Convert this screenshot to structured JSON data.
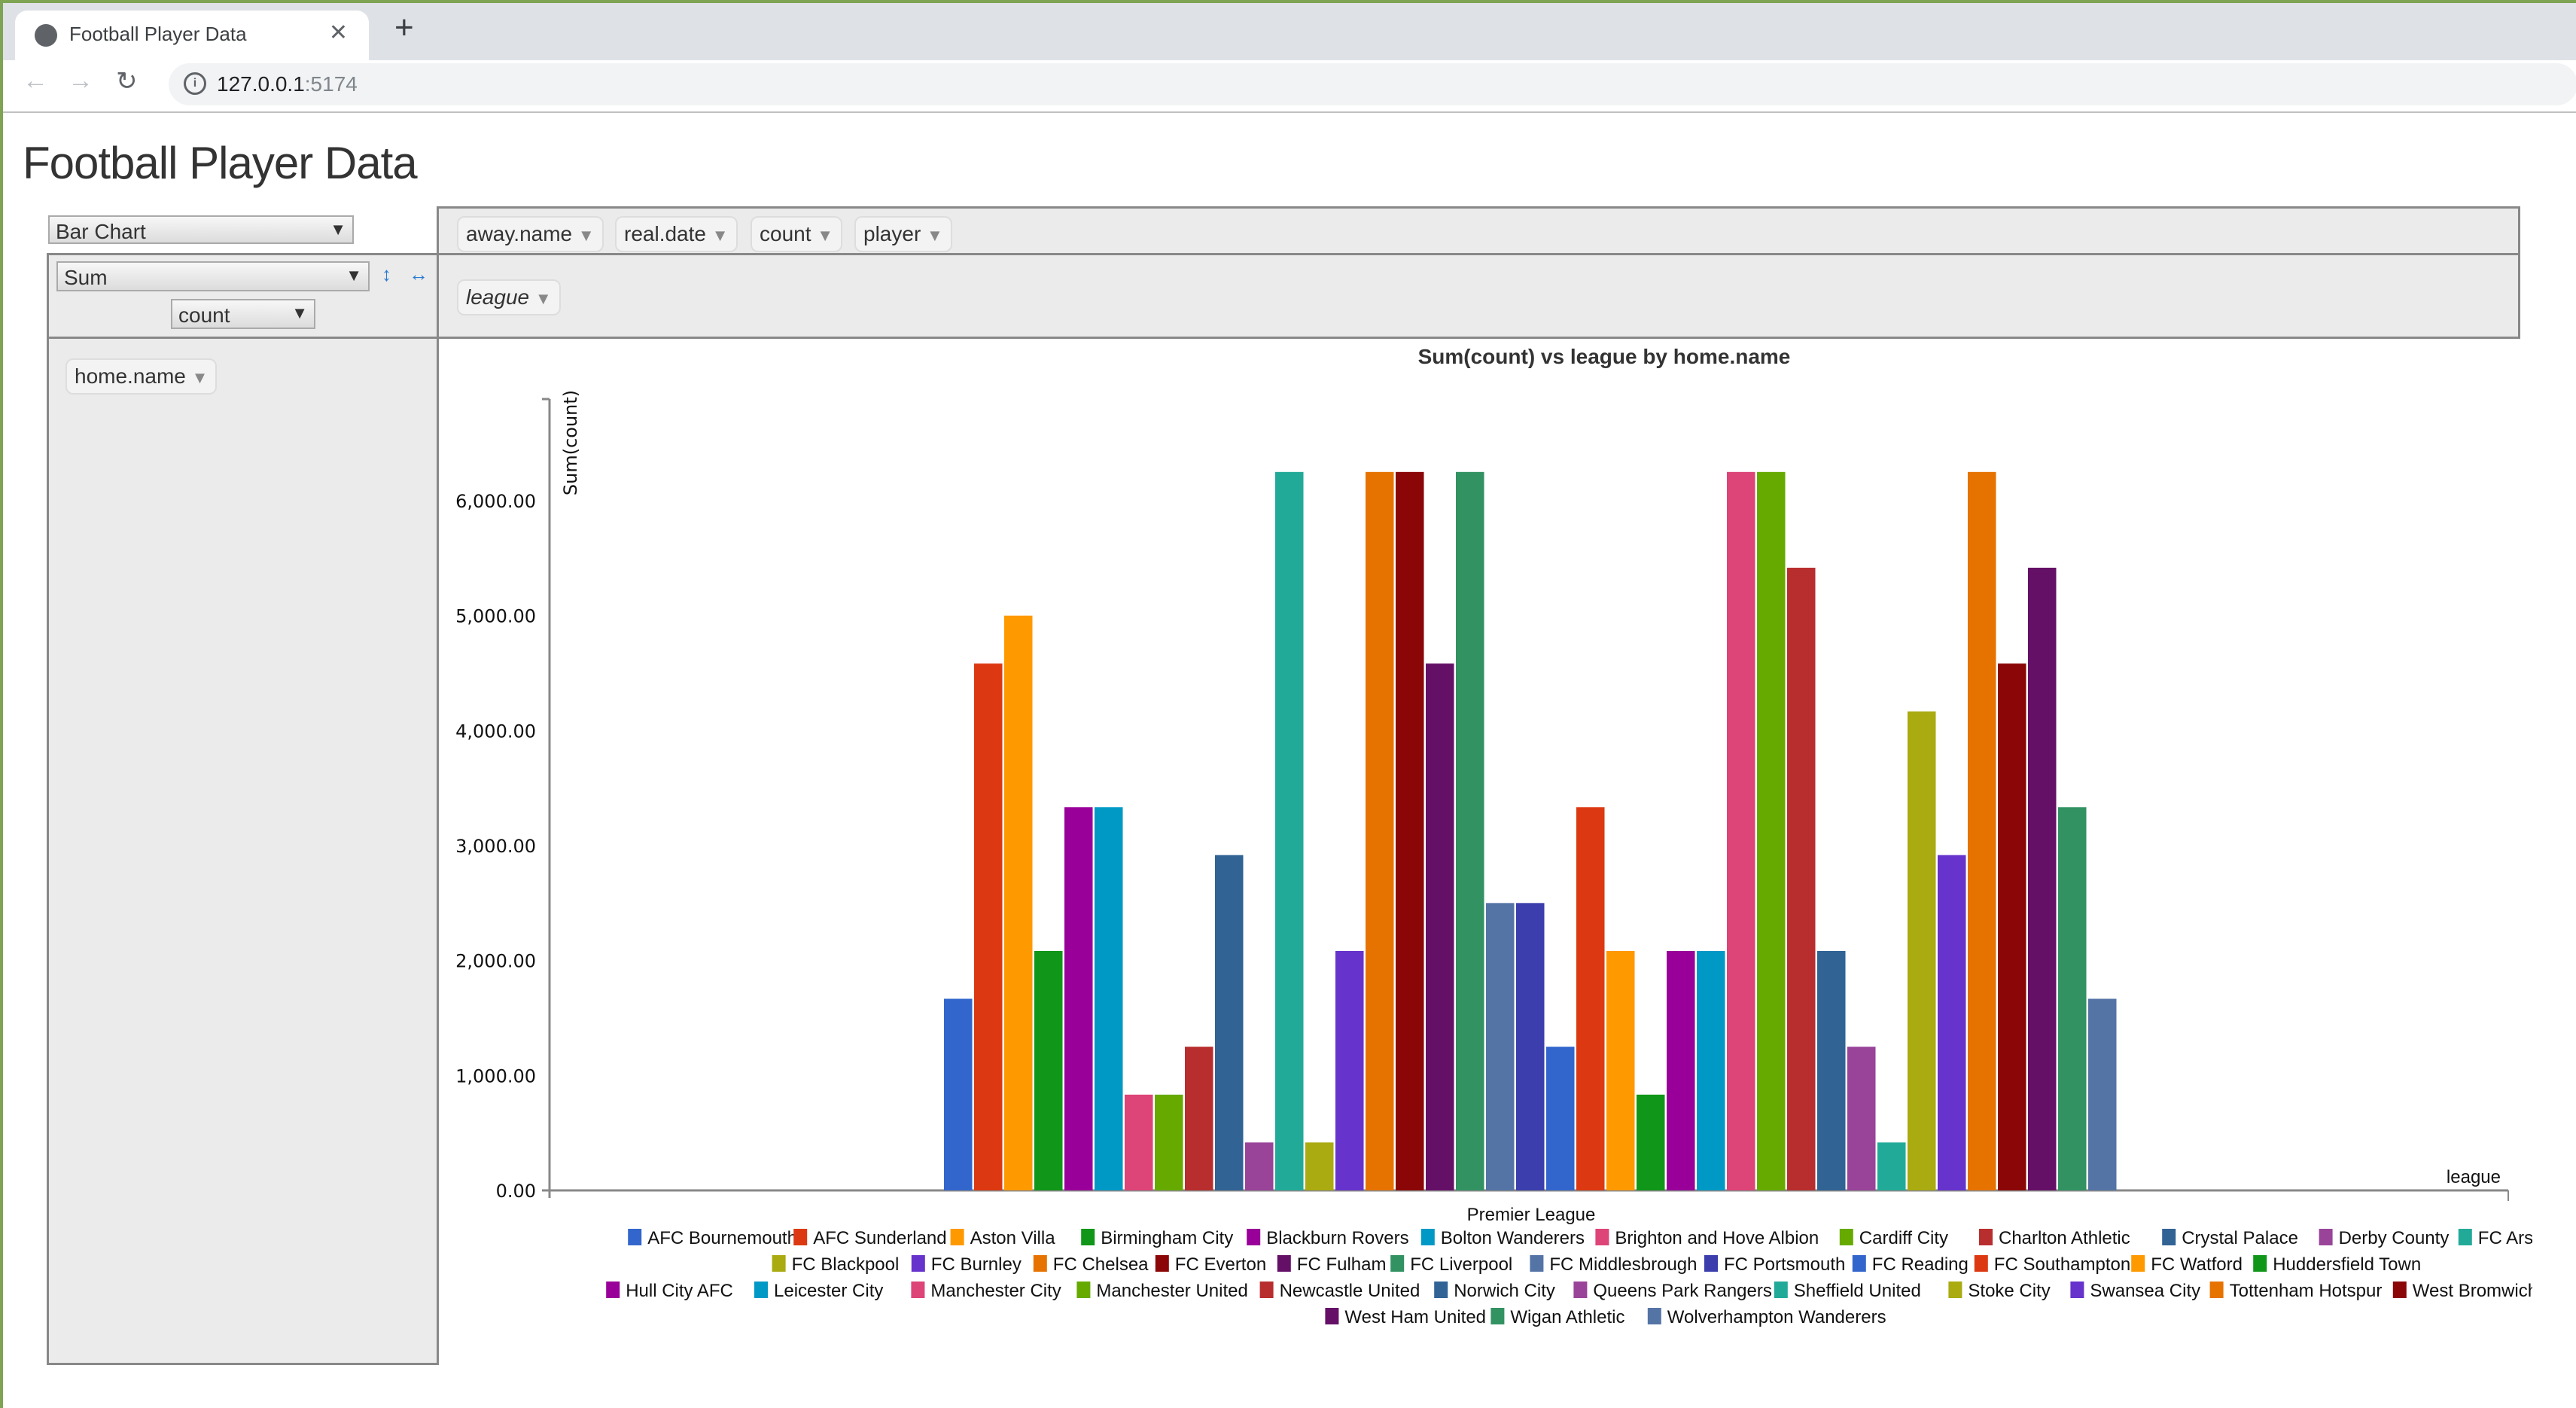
{
  "browser": {
    "tab_title": "Football Player Data",
    "url_host": "127.0.0.1",
    "url_port": ":5174"
  },
  "page": {
    "title": "Football Player Data"
  },
  "controls": {
    "renderer": "Bar Chart",
    "aggregator": "Sum",
    "aggregator_field": "count",
    "sort_row_icon": "↕",
    "sort_col_icon": "↔"
  },
  "unused_attributes": [
    "away.name",
    "real.date",
    "count",
    "player"
  ],
  "column_attributes": [
    "league"
  ],
  "row_attributes": [
    "home.name"
  ],
  "chart_data": {
    "type": "bar",
    "title": "Sum(count) vs league by home.name",
    "xlabel": "league",
    "ylabel": "Sum(count)",
    "categories": [
      "Premier League"
    ],
    "ylim": [
      0,
      6900
    ],
    "yticks": [
      "0.00",
      "1,000.00",
      "2,000.00",
      "3,000.00",
      "4,000.00",
      "5,000.00",
      "6,000.00"
    ],
    "legend_position": "bottom",
    "grid": false,
    "series": [
      {
        "name": "AFC Bournemouth",
        "color": "#3366cc",
        "values": [
          1667
        ]
      },
      {
        "name": "AFC Sunderland",
        "color": "#dc3912",
        "values": [
          4583
        ]
      },
      {
        "name": "Aston Villa",
        "color": "#ff9900",
        "values": [
          5000
        ]
      },
      {
        "name": "Birmingham City",
        "color": "#109618",
        "values": [
          2083
        ]
      },
      {
        "name": "Blackburn Rovers",
        "color": "#990099",
        "values": [
          3333
        ]
      },
      {
        "name": "Bolton Wanderers",
        "color": "#0099c6",
        "values": [
          3333
        ]
      },
      {
        "name": "Brighton and Hove Albion",
        "color": "#dd4477",
        "values": [
          833
        ]
      },
      {
        "name": "Cardiff City",
        "color": "#66aa00",
        "values": [
          833
        ]
      },
      {
        "name": "Charlton Athletic",
        "color": "#b82e2e",
        "values": [
          1250
        ]
      },
      {
        "name": "Crystal Palace",
        "color": "#316395",
        "values": [
          2917
        ]
      },
      {
        "name": "Derby County",
        "color": "#994499",
        "values": [
          417
        ]
      },
      {
        "name": "FC Arsenal",
        "color": "#22aa99",
        "values": [
          6250
        ]
      },
      {
        "name": "FC Blackpool",
        "color": "#aaaa11",
        "values": [
          417
        ]
      },
      {
        "name": "FC Burnley",
        "color": "#6633cc",
        "values": [
          2083
        ]
      },
      {
        "name": "FC Chelsea",
        "color": "#e67300",
        "values": [
          6250
        ]
      },
      {
        "name": "FC Everton",
        "color": "#8b0707",
        "values": [
          6250
        ]
      },
      {
        "name": "FC Fulham",
        "color": "#651067",
        "values": [
          4583
        ]
      },
      {
        "name": "FC Liverpool",
        "color": "#329262",
        "values": [
          6250
        ]
      },
      {
        "name": "FC Middlesbrough",
        "color": "#5574a6",
        "values": [
          2500
        ]
      },
      {
        "name": "FC Portsmouth",
        "color": "#3b3eac",
        "values": [
          2500
        ]
      },
      {
        "name": "FC Reading",
        "color": "#3366cc",
        "values": [
          1250
        ]
      },
      {
        "name": "FC Southampton",
        "color": "#dc3912",
        "values": [
          3333
        ]
      },
      {
        "name": "FC Watford",
        "color": "#ff9900",
        "values": [
          2083
        ]
      },
      {
        "name": "Huddersfield Town",
        "color": "#109618",
        "values": [
          833
        ]
      },
      {
        "name": "Hull City AFC",
        "color": "#990099",
        "values": [
          2083
        ]
      },
      {
        "name": "Leicester City",
        "color": "#0099c6",
        "values": [
          2083
        ]
      },
      {
        "name": "Manchester City",
        "color": "#dd4477",
        "values": [
          6250
        ]
      },
      {
        "name": "Manchester United",
        "color": "#66aa00",
        "values": [
          6250
        ]
      },
      {
        "name": "Newcastle United",
        "color": "#b82e2e",
        "values": [
          5417
        ]
      },
      {
        "name": "Norwich City",
        "color": "#316395",
        "values": [
          2083
        ]
      },
      {
        "name": "Queens Park Rangers",
        "color": "#994499",
        "values": [
          1250
        ]
      },
      {
        "name": "Sheffield United",
        "color": "#22aa99",
        "values": [
          417
        ]
      },
      {
        "name": "Stoke City",
        "color": "#aaaa11",
        "values": [
          4167
        ]
      },
      {
        "name": "Swansea City",
        "color": "#6633cc",
        "values": [
          2917
        ]
      },
      {
        "name": "Tottenham Hotspur",
        "color": "#e67300",
        "values": [
          6250
        ]
      },
      {
        "name": "West Bromwich Albion",
        "color": "#8b0707",
        "values": [
          4583
        ]
      },
      {
        "name": "West Ham United",
        "color": "#651067",
        "values": [
          5417
        ]
      },
      {
        "name": "Wigan Athletic",
        "color": "#329262",
        "values": [
          3333
        ]
      },
      {
        "name": "Wolverhampton Wanderers",
        "color": "#5574a6",
        "values": [
          1667
        ]
      }
    ]
  }
}
